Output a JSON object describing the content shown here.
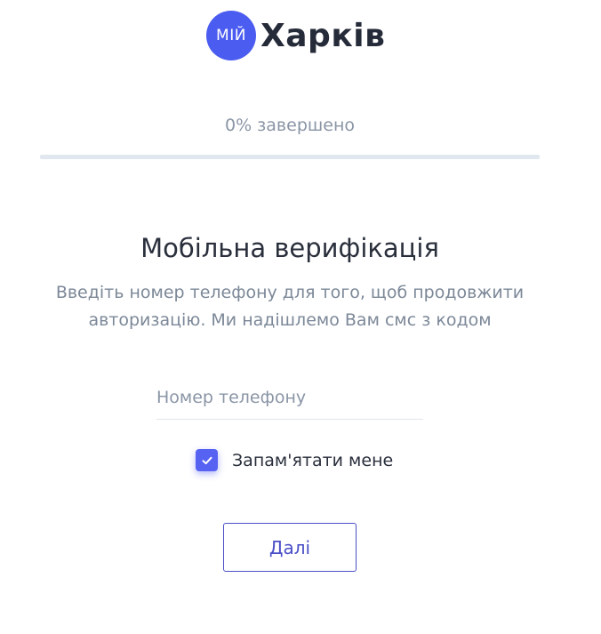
{
  "logo": {
    "badge_text": "МІЙ",
    "word": "Харків",
    "color": "#4b5cf0"
  },
  "progress": {
    "label": "0% завершено",
    "percent": 0
  },
  "verification": {
    "title": "Мобільна верифікація",
    "subtitle_line1": "Введіть номер телефону для того, щоб продовжити",
    "subtitle_line2": "авторизацію. Ми надішлемо Вам смс з кодом"
  },
  "phone": {
    "value": "",
    "placeholder": "Номер телефону"
  },
  "remember_me": {
    "label": "Запам'ятати мене",
    "checked": true,
    "icon": "check-icon"
  },
  "next_button": {
    "label": "Далі"
  }
}
